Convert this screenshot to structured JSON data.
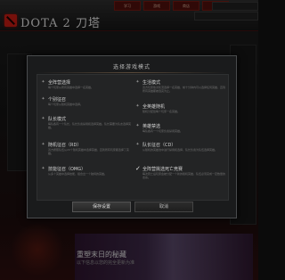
{
  "app": {
    "brand": "DOTA 2 刀塔",
    "nav_tabs": [
      "学习",
      "游戏",
      "商店",
      "设置"
    ],
    "news_title": "重塑末日的秘藏",
    "news_subtitle": "以下信息以您的完全更新为准"
  },
  "dialog": {
    "title": "选择游戏模式",
    "modes": [
      {
        "name": "全阵营选择",
        "desc": "每个玩家从所有英雄中选择一名英雄。",
        "checked": false
      },
      {
        "name": "生活模式",
        "desc": "双方玩家依次轮流选择一名英雄，前十分钟内可以选择任何英雄，直到所有英雄都被选完为止。",
        "checked": false
      },
      {
        "name": "个别征召",
        "desc": "每个玩家从随机英雄中选择。",
        "checked": false
      },
      {
        "name": "全英雄随机",
        "desc": "随机分配给每个玩家一名英雄。",
        "checked": false
      },
      {
        "name": "队长模式",
        "desc": "每队各有一个队长，队长负责禁用和选择英雄。队长需要为队友选择英雄。",
        "checked": false
      },
      {
        "name": "英雄禁选",
        "desc": "每队各有一个玩家负责禁用英雄。",
        "checked": false
      },
      {
        "name": "随机征召（RD）",
        "desc": "双方按照队伍从20个随机英雄中选择英雄，直到所有玩家都选择了英雄。",
        "checked": false
      },
      {
        "name": "队长征召（CD）",
        "desc": "从随机的英雄池中进行禁用和选择，队长负责为队伍选择英雄。",
        "checked": false
      },
      {
        "name": "技能征召（OMG）",
        "desc": "从多个英雄中选择技能，组合出一个独特的英雄。",
        "checked": false
      },
      {
        "name": "全阵营挑选死亡竞赛",
        "desc": "每次死亡后玩家会被分配一个新的随机英雄，队伍必须完成一定数量的击杀。",
        "checked": true
      }
    ],
    "save_label": "保存设置",
    "cancel_label": "取消"
  }
}
